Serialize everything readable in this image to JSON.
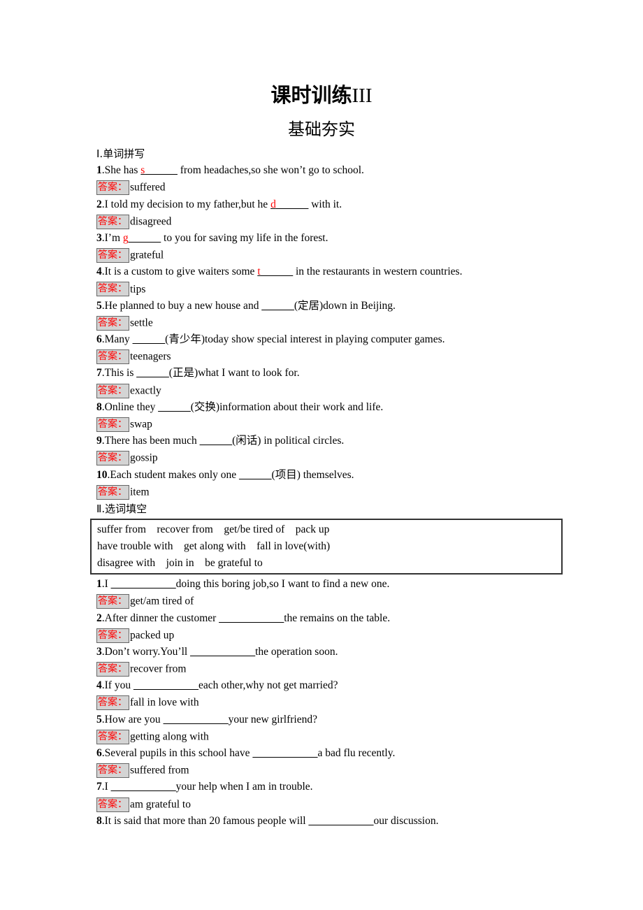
{
  "header": {
    "title_cn": "课时训练",
    "title_roman": "III",
    "subtitle": "基础夯实"
  },
  "answer_label": "答案：",
  "section1": {
    "heading": "Ⅰ.单词拼写",
    "items": [
      {
        "num": "1",
        "before": ".She has ",
        "hint": "s",
        "blank": "______",
        "after": " from headaches,so she won’t go to school.",
        "answer": "suffered"
      },
      {
        "num": "2",
        "before": ".I told my decision to my father,but he ",
        "hint": "d",
        "blank": "______",
        "after": " with it.",
        "answer": "disagreed"
      },
      {
        "num": "3",
        "before": ".I’m ",
        "hint": "g",
        "blank": "______",
        "after": " to you for saving my life in the forest.",
        "answer": "grateful"
      },
      {
        "num": "4",
        "before": ".It is a custom to give waiters some ",
        "hint": "t",
        "blank": "______",
        "after": " in the restaurants in western countries.",
        "answer": "tips"
      },
      {
        "num": "5",
        "before": ".He planned to buy a new house and ",
        "hint": "",
        "blank": "______",
        "after": "(定居)down in Beijing.",
        "answer": "settle"
      },
      {
        "num": "6",
        "before": ".Many ",
        "hint": "",
        "blank": "______",
        "after": "(青少年)today show special interest in playing computer games.",
        "answer": "teenagers"
      },
      {
        "num": "7",
        "before": ".This is ",
        "hint": "",
        "blank": "______",
        "after": "(正是)what I want to look for.",
        "answer": "exactly"
      },
      {
        "num": "8",
        "before": ".Online they ",
        "hint": "",
        "blank": "______",
        "after": "(交换)information about their work and life.",
        "answer": "swap"
      },
      {
        "num": "9",
        "before": ".There has been much ",
        "hint": "",
        "blank": "______",
        "after": "(闲话) in political circles.",
        "answer": "gossip"
      },
      {
        "num": "10",
        "before": ".Each student makes only one ",
        "hint": "",
        "blank": "______",
        "after": "(项目) themselves.",
        "answer": "item"
      }
    ]
  },
  "section2": {
    "heading": "Ⅱ.选词填空",
    "word_box_lines": [
      "suffer from    recover from    get/be tired of    pack up",
      "have trouble with    get along with    fall in love(with)",
      "disagree with    join in    be grateful to"
    ],
    "items": [
      {
        "num": "1",
        "before": ".I ",
        "blank": "____________",
        "after": "doing this boring job,so I want to find a new one.",
        "answer": "get/am tired of"
      },
      {
        "num": "2",
        "before": ".After dinner the customer ",
        "blank": "____________",
        "after": "the remains on the table.",
        "answer": "packed up"
      },
      {
        "num": "3",
        "before": ".Don’t worry.You’ll ",
        "blank": "____________",
        "after": "the operation soon.",
        "answer": "recover from"
      },
      {
        "num": "4",
        "before": ".If you ",
        "blank": "____________",
        "after": "each other,why not get married?",
        "answer": "fall in love with"
      },
      {
        "num": "5",
        "before": ".How are you ",
        "blank": "____________",
        "after": "your new girlfriend?",
        "answer": "getting along with"
      },
      {
        "num": "6",
        "before": ".Several pupils in this school have ",
        "blank": "____________",
        "after": "a bad flu recently.",
        "answer": "suffered from"
      },
      {
        "num": "7",
        "before": ".I ",
        "blank": "____________",
        "after": "your help when I am in trouble.",
        "answer": "am grateful to"
      },
      {
        "num": "8",
        "before": ".It is said that more than 20 famous people will ",
        "blank": "____________",
        "after": "our discussion.",
        "answer": null
      }
    ]
  }
}
